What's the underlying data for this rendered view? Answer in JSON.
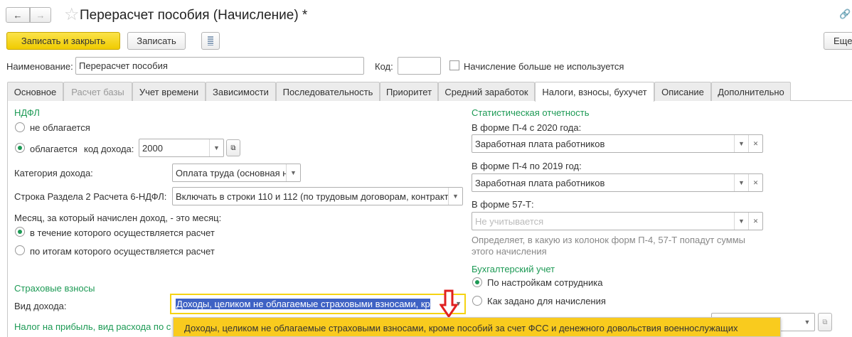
{
  "header": {
    "title": "Перерасчет пособия (Начисление) *",
    "more_label": "Еще"
  },
  "toolbar": {
    "save_close": "Записать и закрыть",
    "save": "Записать"
  },
  "form": {
    "name_label": "Наименование:",
    "name_value": "Перерасчет пособия",
    "code_label": "Код:",
    "code_value": "",
    "unused_label": "Начисление больше не используется"
  },
  "tabs": [
    "Основное",
    "Расчет базы",
    "Учет времени",
    "Зависимости",
    "Последовательность",
    "Приоритет",
    "Средний заработок",
    "Налоги, взносы, бухучет",
    "Описание",
    "Дополнительно"
  ],
  "ndfl": {
    "title": "НДФЛ",
    "opt_no": "не облагается",
    "opt_yes": "облагается",
    "income_code_label": "код дохода:",
    "income_code": "2000",
    "category_label": "Категория дохода:",
    "category_value": "Оплата труда (основная н",
    "row_label": "Строка Раздела 2 Расчета 6-НДФЛ:",
    "row_value": "Включать в строки 110 и 112 (по трудовым договорам, контракт",
    "month_label": "Месяц, за который начислен доход, - это месяц:",
    "month_opt1": "в течение которого осуществляется расчет",
    "month_opt2": "по итогам которого осуществляется расчет"
  },
  "insurance": {
    "title": "Страховые взносы",
    "income_kind_label": "Вид дохода:",
    "income_kind_value": "Доходы, целиком не облагаемые страховыми взносами, кро",
    "tooltip": "Доходы, целиком не облагаемые страховыми взносами, кроме пособий за счет ФСС и денежного довольствия военнослужащих"
  },
  "profit_tax": {
    "label": "Налог на прибыль, вид расхода по с"
  },
  "stats": {
    "title": "Статистическая отчетность",
    "p4_2020_label": "В форме П-4 с 2020 года:",
    "p4_2020_value": "Заработная плата работников",
    "p4_2019_label": "В форме П-4 по 2019 год:",
    "p4_2019_value": "Заработная плата работников",
    "f57_label": "В форме 57-Т:",
    "f57_placeholder": "Не учитывается",
    "note": "Определяет, в какую из колонок форм П-4, 57-Т попадут суммы",
    "note2": "этого начисления"
  },
  "accounting": {
    "title": "Бухгалтерский учет",
    "opt1": "По настройкам сотрудника",
    "opt2": "Как задано для начисления"
  },
  "colors": {
    "accent": "#f5d313",
    "green": "#1d9a55",
    "selection": "#3e62c4"
  }
}
